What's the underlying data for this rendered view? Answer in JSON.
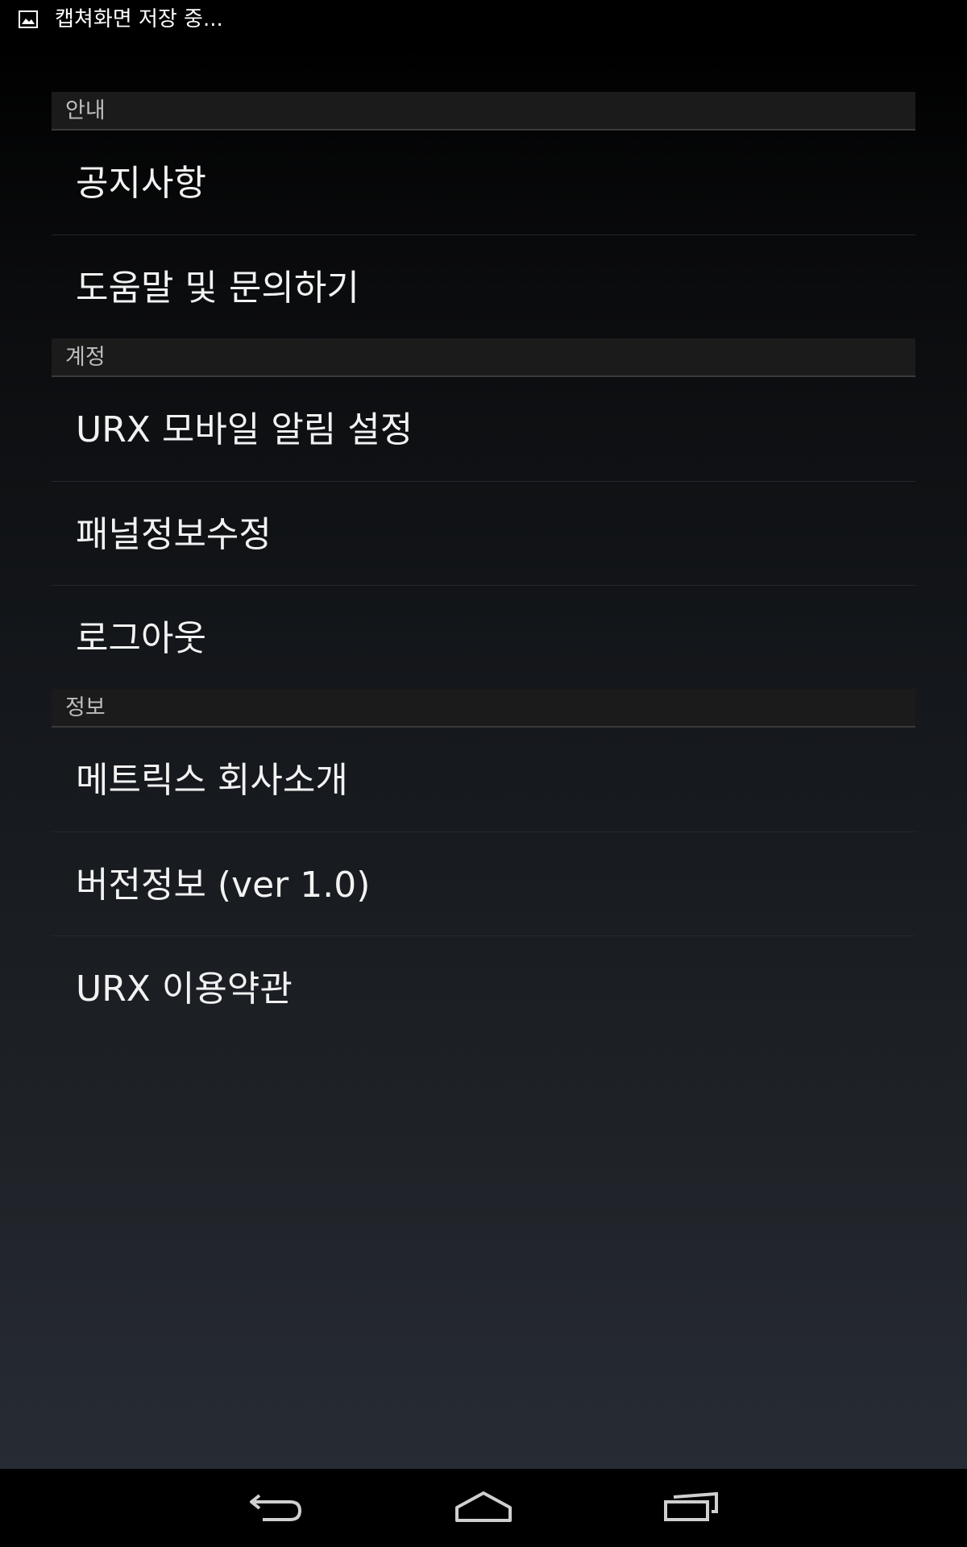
{
  "status_bar": {
    "notification_icon": "image-icon",
    "notification_text": "캡쳐화면 저장 중..."
  },
  "sections": [
    {
      "header": "안내",
      "items": [
        "공지사항",
        "도움말 및 문의하기"
      ]
    },
    {
      "header": "계정",
      "items": [
        "URX 모바일 알림 설정",
        "패널정보수정",
        "로그아웃"
      ]
    },
    {
      "header": "정보",
      "items": [
        "메트릭스 회사소개",
        "버전정보 (ver 1.0)",
        "URX 이용약관"
      ]
    }
  ],
  "nav_bar": {
    "back_icon": "back-arrow-icon",
    "home_icon": "home-icon",
    "recent_icon": "recent-apps-icon"
  },
  "colors": {
    "section_header_bg": "#1b1b1b",
    "section_header_text": "#bdbdbd",
    "item_text": "#f2f2f2"
  }
}
